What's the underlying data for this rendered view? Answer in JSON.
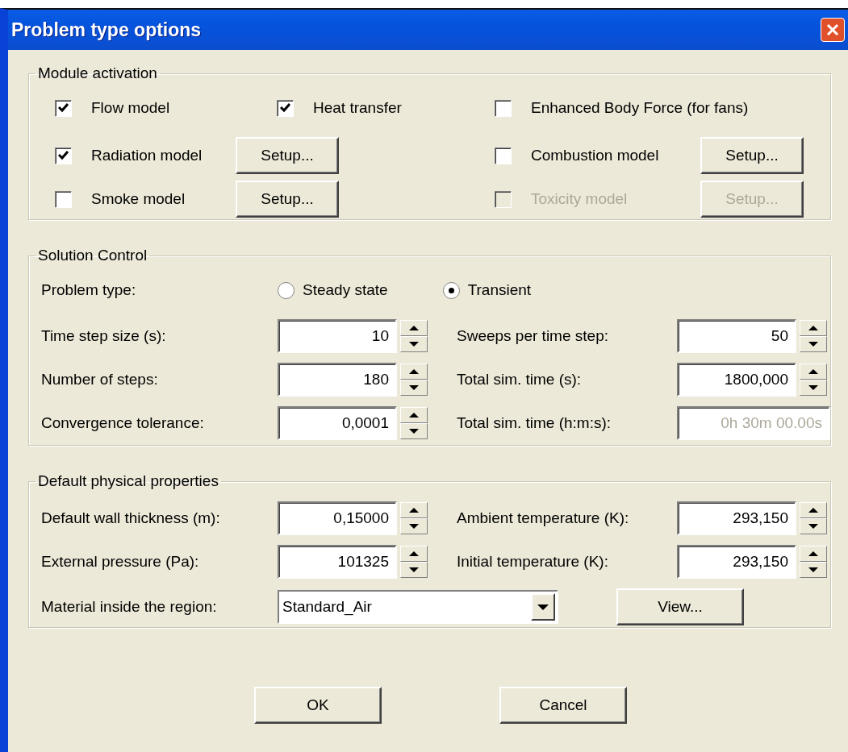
{
  "window": {
    "title": "Problem type options"
  },
  "module_activation": {
    "legend": "Module activation",
    "rows": [
      {
        "cells": [
          {
            "kind": "checkbox",
            "label": "Flow model",
            "checked": true,
            "disabled": false
          },
          {
            "kind": "checkbox",
            "label": "Heat transfer",
            "checked": true,
            "disabled": false
          },
          {
            "kind": "checkbox",
            "label": "Enhanced Body Force (for fans)",
            "checked": false,
            "disabled": false
          }
        ]
      },
      {
        "cells": [
          {
            "kind": "checkbox",
            "label": "Radiation model",
            "checked": true,
            "disabled": false
          },
          {
            "kind": "button",
            "label": "Setup...",
            "disabled": false
          },
          {
            "kind": "checkbox",
            "label": "Combustion model",
            "checked": false,
            "disabled": false
          },
          {
            "kind": "button",
            "label": "Setup...",
            "disabled": false
          }
        ]
      },
      {
        "cells": [
          {
            "kind": "checkbox",
            "label": "Smoke model",
            "checked": false,
            "disabled": false
          },
          {
            "kind": "button",
            "label": "Setup...",
            "disabled": false
          },
          {
            "kind": "checkbox",
            "label": "Toxicity model",
            "checked": false,
            "disabled": true
          },
          {
            "kind": "button",
            "label": "Setup...",
            "disabled": true
          }
        ]
      }
    ]
  },
  "solution_control": {
    "legend": "Solution Control",
    "problem_type": {
      "label": "Problem type:",
      "options": [
        {
          "label": "Steady state",
          "selected": false
        },
        {
          "label": "Transient",
          "selected": true
        }
      ]
    },
    "rows": [
      {
        "cells": [
          {
            "kind": "label",
            "text": "Time step size (s):"
          },
          {
            "kind": "spin",
            "value": "10"
          },
          {
            "kind": "label",
            "text": "Sweeps per time step:"
          },
          {
            "kind": "spin",
            "value": "50"
          }
        ]
      },
      {
        "cells": [
          {
            "kind": "label",
            "text": "Number of steps:"
          },
          {
            "kind": "spin",
            "value": "180"
          },
          {
            "kind": "label",
            "text": "Total sim. time (s):"
          },
          {
            "kind": "spin",
            "value": "1800,000"
          }
        ]
      },
      {
        "cells": [
          {
            "kind": "label",
            "text": "Convergence tolerance:"
          },
          {
            "kind": "spin",
            "value": "0,0001"
          },
          {
            "kind": "label",
            "text": "Total sim. time (h:m:s):"
          },
          {
            "kind": "readonly",
            "value": "0h 30m 00.00s"
          }
        ]
      }
    ]
  },
  "physical_properties": {
    "legend": "Default physical properties",
    "rows": [
      {
        "cells": [
          {
            "kind": "label",
            "text": "Default wall thickness (m):"
          },
          {
            "kind": "spin",
            "value": "0,15000"
          },
          {
            "kind": "label",
            "text": "Ambient temperature (K):"
          },
          {
            "kind": "spin",
            "value": "293,150"
          }
        ]
      },
      {
        "cells": [
          {
            "kind": "label",
            "text": "External pressure (Pa):"
          },
          {
            "kind": "spin",
            "value": "101325"
          },
          {
            "kind": "label",
            "text": "Initial temperature (K):"
          },
          {
            "kind": "spin",
            "value": "293,150"
          }
        ]
      },
      {
        "cells": [
          {
            "kind": "label",
            "text": "Material inside the region:"
          },
          {
            "kind": "combo",
            "value": "Standard_Air"
          },
          {
            "kind": "button",
            "label": "View..."
          }
        ]
      }
    ]
  },
  "buttons": [
    {
      "label": "OK"
    },
    {
      "label": "Cancel"
    }
  ]
}
